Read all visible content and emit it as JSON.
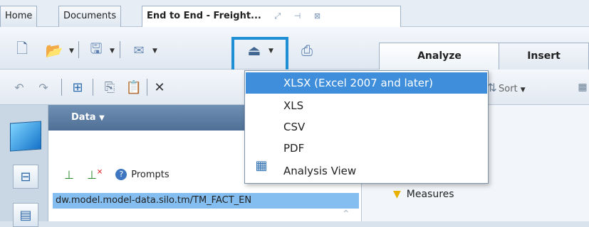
{
  "tabs": [
    {
      "label": "Home"
    },
    {
      "label": "Documents"
    },
    {
      "label": "End to End - Freight...",
      "icons": [
        "restore-icon",
        "pin-icon",
        "close-icon"
      ]
    }
  ],
  "ribbon_tabs": [
    {
      "label": "Analyze"
    },
    {
      "label": "Insert"
    }
  ],
  "toolbar2": {
    "sort_label": "Sort"
  },
  "export_menu": {
    "items": [
      {
        "label": "XLSX (Excel 2007 and later)",
        "selected": true
      },
      {
        "label": "XLS"
      },
      {
        "label": "CSV"
      },
      {
        "label": "PDF"
      },
      {
        "label": "Analysis View"
      }
    ]
  },
  "data_panel": {
    "title": "Data",
    "prompts_label": "Prompts",
    "query_path": "dw.model.model-data.silo.tm/TM_FACT_EN"
  },
  "right_panel": {
    "measures_label": "Measures"
  },
  "colors": {
    "highlight": "#1e8fd5",
    "menu_selected": "#3f8edb",
    "query_selected": "#84bdf0"
  }
}
